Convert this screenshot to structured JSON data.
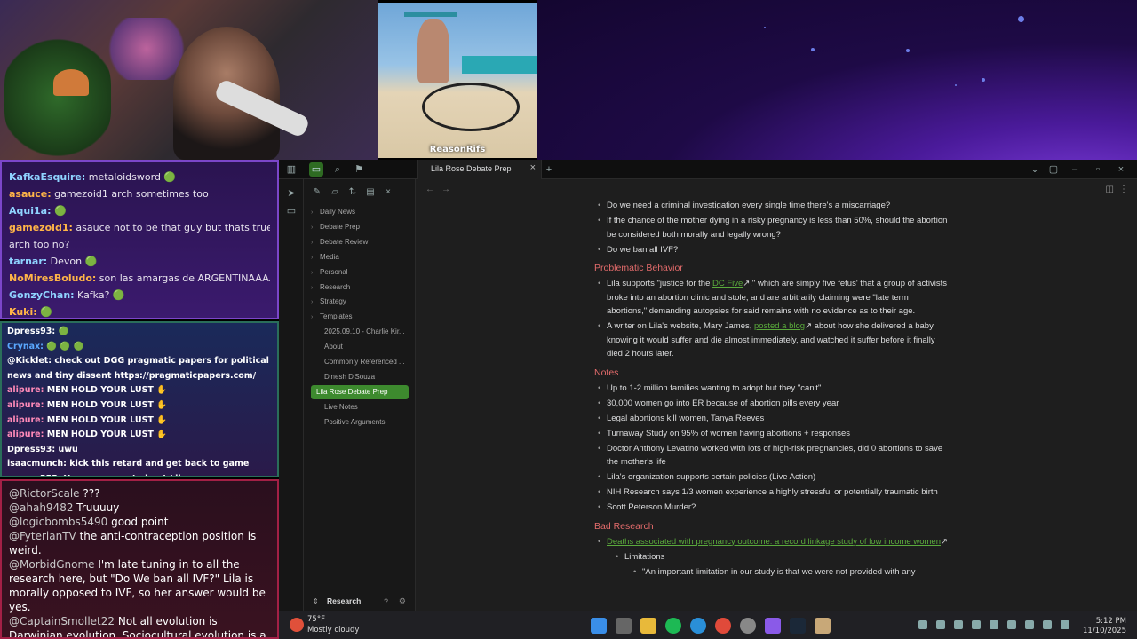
{
  "webcam": {
    "overlay_tag": "ReasonRifs"
  },
  "chat_top": [
    {
      "user": "KafkaEsquire",
      "color": "#8fd3ff",
      "text": " metaloidsword 🟢"
    },
    {
      "user": "asauce",
      "color": "#ffb547",
      "text": " gamezoid1 arch sometimes too"
    },
    {
      "user": "Aqui1a",
      "color": "#8fd3ff",
      "text": " 🟢"
    },
    {
      "user": "gamezoid1",
      "color": "#ffb547",
      "text": " asauce not to be that guy but thats true of"
    },
    {
      "user": "",
      "color": "#ffffff",
      "text": "arch too no?"
    },
    {
      "user": "tarnar",
      "color": "#8fd3ff",
      "text": " Devon 🟢"
    },
    {
      "user": "NoMiresBoludo",
      "color": "#ffb547",
      "text": " son las amargas de ARGENTINAAAAAAA"
    },
    {
      "user": "GonzyChan",
      "color": "#8fd3ff",
      "text": " Kafka? 🟢"
    },
    {
      "user": "Kuki",
      "color": "#ffb547",
      "text": " 🟢"
    }
  ],
  "chat_mid": [
    {
      "user": "Dpress93",
      "color": "#ffffff",
      "text": " 🟢"
    },
    {
      "user": "Crynax",
      "color": "#5aa8ff",
      "text": " 🟢 🟢 🟢"
    },
    {
      "user": "@Kicklet",
      "color": "#ffffff",
      "text": " check out DGG pragmatic papers for political"
    },
    {
      "user": "",
      "color": "#ffffff",
      "text": "news and tiny dissent https://pragmaticpapers.com/"
    },
    {
      "user": "alipure",
      "color": "#ff8ab8",
      "text": " MEN HOLD YOUR LUST ✋"
    },
    {
      "user": "alipure",
      "color": "#ff8ab8",
      "text": " MEN HOLD YOUR LUST ✋"
    },
    {
      "user": "alipure",
      "color": "#ff8ab8",
      "text": " MEN HOLD YOUR LUST ✋"
    },
    {
      "user": "alipure",
      "color": "#ff8ab8",
      "text": " MEN HOLD YOUR LUST ✋"
    },
    {
      "user": "Dpress93",
      "color": "#ffffff",
      "text": " uwu"
    },
    {
      "user": "isaacmunch",
      "color": "#ffffff",
      "text": " kick this retard and get back to game"
    },
    {
      "user": "copper555",
      "color": "#ffffff",
      "text": " You are correct about Lila."
    }
  ],
  "chat_bottom": [
    {
      "user": "@RictorScale",
      "text": " ???"
    },
    {
      "user": "@ahah9482",
      "text": " Truuuuy"
    },
    {
      "user": "@logicbombs5490",
      "text": " good point"
    },
    {
      "user": "@FyterianTV",
      "text": " the anti-contraception position is weird."
    },
    {
      "user": "@MorbidGnome",
      "text": " I'm late tuning in to all the research here, but \"Do We ban all IVF?\" Lila is morally opposed to IVF, so her answer would be yes."
    },
    {
      "user": "@CaptainSmollet22",
      "text": " Not all evolution is Darwinian evolution. Sociocultural evolution is a real thing."
    }
  ],
  "app": {
    "tab_title": "Lila Rose Debate Prep",
    "vault_name": "Research",
    "tree": [
      {
        "label": "Daily News",
        "folder": true
      },
      {
        "label": "Debate Prep",
        "folder": true
      },
      {
        "label": "Debate Review",
        "folder": true
      },
      {
        "label": "Media",
        "folder": true
      },
      {
        "label": "Personal",
        "folder": true
      },
      {
        "label": "Research",
        "folder": true
      },
      {
        "label": "Strategy",
        "folder": true
      },
      {
        "label": "Templates",
        "folder": true
      },
      {
        "label": "2025.09.10 - Charlie Kir...",
        "folder": false
      },
      {
        "label": "About",
        "folder": false
      },
      {
        "label": "Commonly Referenced ...",
        "folder": false
      },
      {
        "label": "Dinesh D'Souza",
        "folder": false
      },
      {
        "label": "Lila Rose Debate Prep",
        "folder": false,
        "active": true
      },
      {
        "label": "Live Notes",
        "folder": false
      },
      {
        "label": "Positive Arguments",
        "folder": false
      }
    ],
    "note": {
      "top_bullets": [
        "Do we need a criminal investigation every single time there's a miscarriage?",
        "If the chance of the mother dying in a risky pregnancy is less than 50%, should the abortion be considered both morally and legally wrong?",
        "Do we ban all IVF?"
      ],
      "problematic_heading": "Problematic Behavior",
      "problematic": {
        "b1_pre": "Lila supports \"justice for the ",
        "b1_link": "DC Five",
        "b1_post": ",\" which are simply five fetus' that a group of activists broke into an abortion clinic and stole, and are arbitrarily claiming were \"late term abortions,\" demanding autopsies for said remains with no evidence as to their age.",
        "b2_pre": "A writer on Lila's website, Mary James, ",
        "b2_link": "posted a blog",
        "b2_post": " about how she delivered a baby, knowing it would suffer and die almost immediately, and watched it suffer before it finally died 2 hours later."
      },
      "notes_heading": "Notes",
      "notes": [
        "Up to 1-2 million families wanting to adopt but they \"can't\"",
        "30,000 women go into ER because of abortion pills every year",
        "Legal abortions kill women, Tanya Reeves",
        "Turnaway Study on 95% of women having abortions + responses",
        "Doctor Anthony Levatino worked with lots of high-risk pregnancies, did 0 abortions to save the mother's life",
        "Lila's organization supports certain policies (Live Action)",
        "NIH Research says 1/3 women experience a highly stressful or potentially traumatic birth",
        "Scott Peterson Murder?"
      ],
      "bad_research_heading": "Bad Research",
      "bad_research_link": "Deaths associated with pregnancy outcome: a record linkage study of low income women",
      "limitations_label": "Limitations",
      "limitation_text": "\"An important limitation in our study is that we were not provided with any"
    }
  },
  "taskbar": {
    "temp": "75°F",
    "weather": "Mostly cloudy",
    "time": "5:12 PM",
    "date": "11/10/2025"
  },
  "colors": {
    "accent_green": "#3d8a2e",
    "heading_red": "#e26b6b",
    "link_green": "#5aaa3c"
  }
}
